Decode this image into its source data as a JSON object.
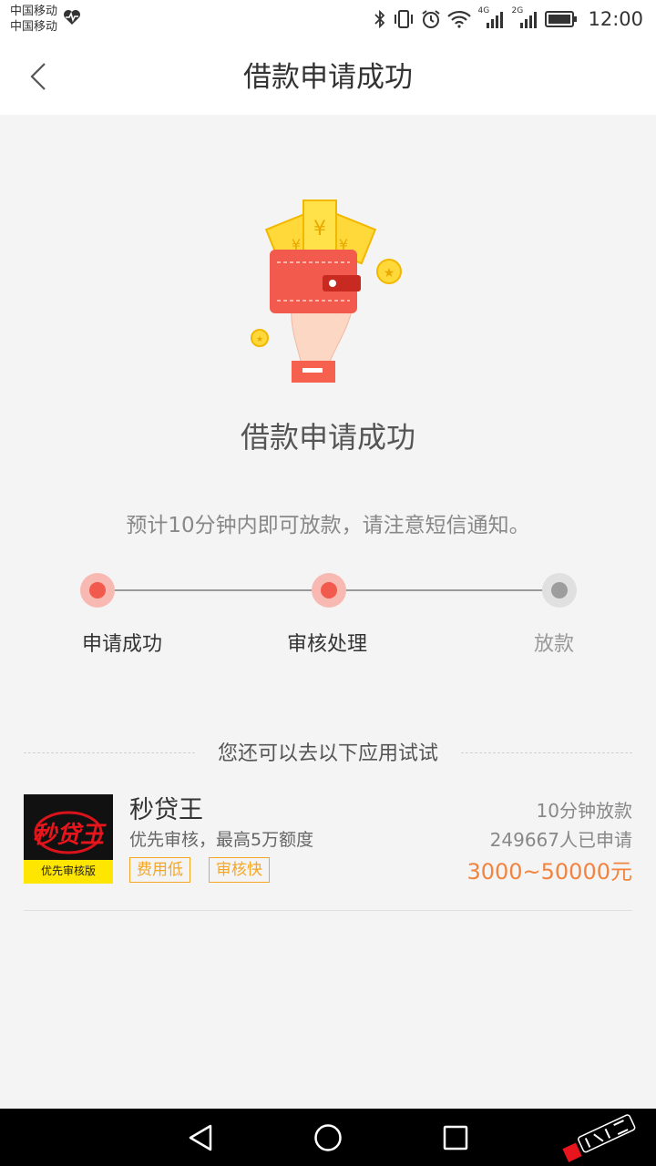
{
  "status_bar": {
    "carrier_1": "中国移动",
    "carrier_2": "中国移动",
    "network_1": "4G",
    "network_2": "2G",
    "time": "12:00"
  },
  "header": {
    "title": "借款申请成功",
    "back_icon": "chevron-left-icon"
  },
  "main": {
    "illustration": "wallet-hand-coins",
    "success_title": "借款申请成功",
    "hint": "预计10分钟内即可放款，请注意短信通知。",
    "steps": [
      {
        "label": "申请成功",
        "state": "done"
      },
      {
        "label": "审核处理",
        "state": "done"
      },
      {
        "label": "放款",
        "state": "pending"
      }
    ]
  },
  "recommend": {
    "title": "您还可以去以下应用试试",
    "apps": [
      {
        "name": "秒贷王",
        "logo_text": "秒贷王",
        "logo_subtext": "优先审核版",
        "desc": "优先审核，最高5万额度",
        "tags": [
          "费用低",
          "审核快"
        ],
        "speed": "10分钟放款",
        "applicants": "249667人已申请",
        "amount_range": "3000~50000元"
      }
    ]
  },
  "system_nav": {
    "back_icon": "triangle-back-icon",
    "home_icon": "circle-home-icon",
    "recents_icon": "square-recents-icon"
  },
  "colors": {
    "accent": "#f25a4d",
    "accent_light": "#f9b9b3",
    "tag": "#f5a623",
    "amount": "#f08440",
    "background": "#f4f4f4"
  }
}
